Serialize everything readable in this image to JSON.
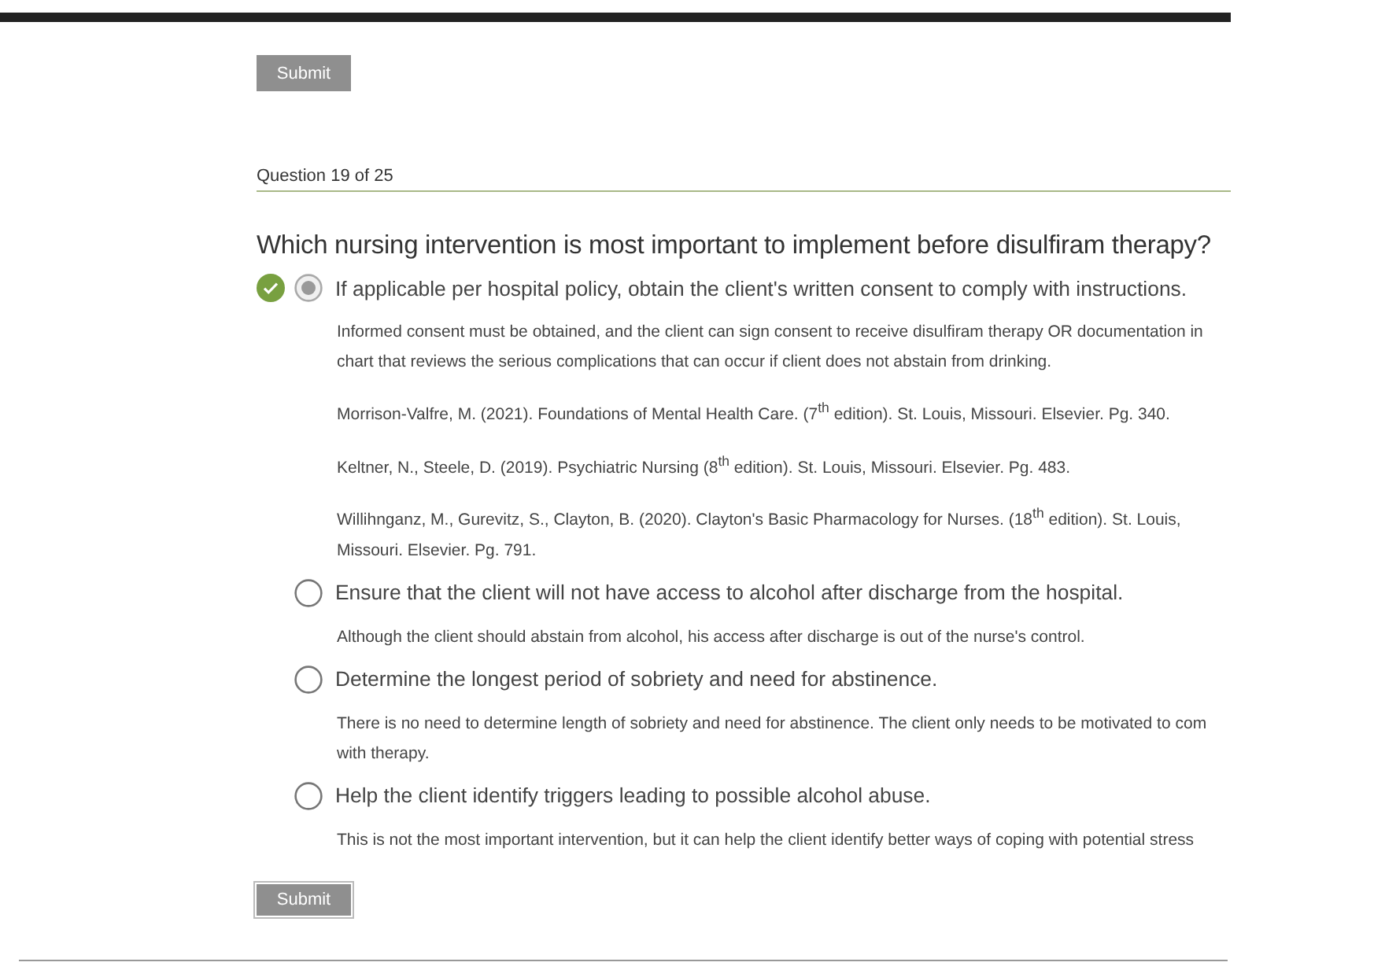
{
  "top_submit": {
    "label": "Submit",
    "disabled": true
  },
  "question_counter": "Question 19 of 25",
  "question": "Which nursing intervention is most important to implement before disulfiram therapy?",
  "options": [
    {
      "text": "If applicable per hospital policy, obtain the client's written consent to comply with instructions.",
      "selected": true,
      "correct": true,
      "rationale": [
        "Informed consent must be obtained, and the client can sign consent to receive disulfiram therapy OR documentation in chart that reviews the serious complications that can occur if client does not abstain from drinking.",
        "Morrison-Valfre, M. (2021). Foundations of Mental Health Care. (7$^{th}$ edition). St. Louis, Missouri. Elsevier. Pg. 340.",
        "Keltner, N., Steele, D. (2019). Psychiatric Nursing (8$^{th}$ edition). St. Louis, Missouri. Elsevier. Pg. 483.",
        "Willihnganz, M., Gurevitz, S., Clayton, B. (2020). Clayton's Basic Pharmacology for Nurses. (18$^{th}$ edition). St. Louis, Missouri. Elsevier. Pg. 791."
      ]
    },
    {
      "text": "Ensure that the client will not have access to alcohol after discharge from the hospital.",
      "selected": false,
      "correct": false,
      "rationale": [
        "Although the client should abstain from alcohol, his access after discharge is out of the nurse's control."
      ]
    },
    {
      "text": "Determine the longest period of sobriety and need for abstinence.",
      "selected": false,
      "correct": false,
      "rationale": [
        "There is no need to determine length of sobriety and need for abstinence. The client only needs to be motivated to com with therapy."
      ]
    },
    {
      "text": "Help the client identify triggers leading to possible alcohol abuse.",
      "selected": false,
      "correct": false,
      "rationale": [
        "This is not the most important intervention, but it can help the client identify better ways of coping with potential stress"
      ]
    }
  ],
  "bottom_submit": {
    "label": "Submit",
    "disabled": true
  }
}
